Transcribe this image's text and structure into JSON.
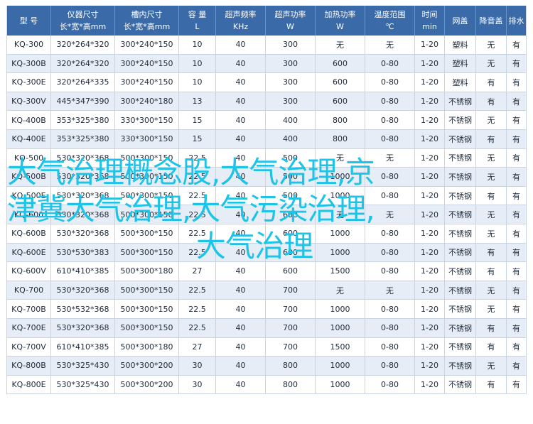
{
  "table": {
    "headers": [
      {
        "l1": "型 号",
        "l2": ""
      },
      {
        "l1": "仪器尺寸",
        "l2": "长*宽*高mm"
      },
      {
        "l1": "槽内尺寸",
        "l2": "长*宽*高mm"
      },
      {
        "l1": "容 量",
        "l2": "L"
      },
      {
        "l1": "超声频率",
        "l2": "KHz"
      },
      {
        "l1": "超声功率",
        "l2": "W"
      },
      {
        "l1": "加热功率",
        "l2": "W"
      },
      {
        "l1": "温度范围",
        "l2": "℃"
      },
      {
        "l1": "时间",
        "l2": "min"
      },
      {
        "l1": "网盖",
        "l2": ""
      },
      {
        "l1": "降音盖",
        "l2": ""
      },
      {
        "l1": "排水",
        "l2": ""
      }
    ],
    "rows": [
      [
        "KQ-300",
        "320*264*320",
        "300*240*150",
        "10",
        "40",
        "300",
        "无",
        "无",
        "1-20",
        "塑料",
        "无",
        "有"
      ],
      [
        "KQ-300B",
        "320*264*320",
        "300*240*150",
        "10",
        "40",
        "300",
        "600",
        "0-80",
        "1-20",
        "塑料",
        "无",
        "有"
      ],
      [
        "KQ-300E",
        "320*264*335",
        "300*240*150",
        "10",
        "40",
        "300",
        "600",
        "0-80",
        "1-20",
        "塑料",
        "有",
        "有"
      ],
      [
        "KQ-300V",
        "445*347*390",
        "300*240*180",
        "13",
        "40",
        "300",
        "600",
        "0-80",
        "1-20",
        "不锈钢",
        "有",
        "有"
      ],
      [
        "KQ-400B",
        "353*325*380",
        "330*300*150",
        "15",
        "40",
        "400",
        "800",
        "0-80",
        "1-20",
        "不锈钢",
        "无",
        "有"
      ],
      [
        "KQ-400E",
        "353*325*380",
        "330*300*150",
        "15",
        "40",
        "400",
        "800",
        "0-80",
        "1-20",
        "不锈钢",
        "有",
        "有"
      ],
      [
        "KQ-500",
        "530*320*368",
        "500*300*150",
        "22.5",
        "40",
        "500",
        "无",
        "无",
        "1-20",
        "不锈钢",
        "无",
        "有"
      ],
      [
        "KQ-500B",
        "530*320*368",
        "500*300*150",
        "22.5",
        "40",
        "500",
        "1000",
        "0-80",
        "1-20",
        "不锈钢",
        "无",
        "有"
      ],
      [
        "KQ-500E",
        "530*320*368",
        "500*300*150",
        "22.5",
        "40",
        "500",
        "1000",
        "0-80",
        "1-20",
        "不锈钢",
        "有",
        "有"
      ],
      [
        "KQ-600",
        "530*320*368",
        "500*300*150",
        "22.5",
        "40",
        "600",
        "无",
        "无",
        "1-20",
        "不锈钢",
        "无",
        "有"
      ],
      [
        "KQ-600B",
        "530*320*368",
        "500*300*150",
        "22.5",
        "40",
        "600",
        "1000",
        "0-80",
        "1-20",
        "不锈钢",
        "无",
        "有"
      ],
      [
        "KQ-600E",
        "530*530*383",
        "500*300*150",
        "22.5",
        "40",
        "600",
        "1000",
        "0-80",
        "1-20",
        "不锈钢",
        "有",
        "有"
      ],
      [
        "KQ-600V",
        "610*410*385",
        "500*300*180",
        "27",
        "40",
        "600",
        "1500",
        "0-80",
        "1-20",
        "不锈钢",
        "有",
        "有"
      ],
      [
        "KQ-700",
        "530*320*368",
        "500*300*150",
        "22.5",
        "40",
        "700",
        "无",
        "无",
        "1-20",
        "不锈钢",
        "无",
        "有"
      ],
      [
        "KQ-700B",
        "530*532*368",
        "500*300*150",
        "22.5",
        "40",
        "700",
        "1000",
        "0-80",
        "1-20",
        "不锈钢",
        "无",
        "有"
      ],
      [
        "KQ-700E",
        "530*320*368",
        "500*300*150",
        "22.5",
        "40",
        "700",
        "1000",
        "0-80",
        "1-20",
        "不锈钢",
        "有",
        "有"
      ],
      [
        "KQ-700V",
        "610*410*385",
        "500*300*180",
        "27",
        "40",
        "700",
        "1500",
        "0-80",
        "1-20",
        "不锈钢",
        "有",
        "有"
      ],
      [
        "KQ-800B",
        "530*325*430",
        "500*300*200",
        "30",
        "40",
        "800",
        "1000",
        "0-80",
        "1-20",
        "不锈钢",
        "无",
        "有"
      ],
      [
        "KQ-800E",
        "530*325*430",
        "500*300*200",
        "30",
        "40",
        "800",
        "1000",
        "0-80",
        "1-20",
        "不锈钢",
        "有",
        "有"
      ]
    ]
  },
  "overlay": {
    "line1": "大气治理概念股,大气治理,京",
    "line2": "津冀大气治理,大气污染治理,",
    "line3": "大气治理"
  },
  "colors": {
    "header_bg": "#3a6ba8",
    "stripe": "#e6edf6",
    "overlay_text": "#1ec3e8"
  }
}
